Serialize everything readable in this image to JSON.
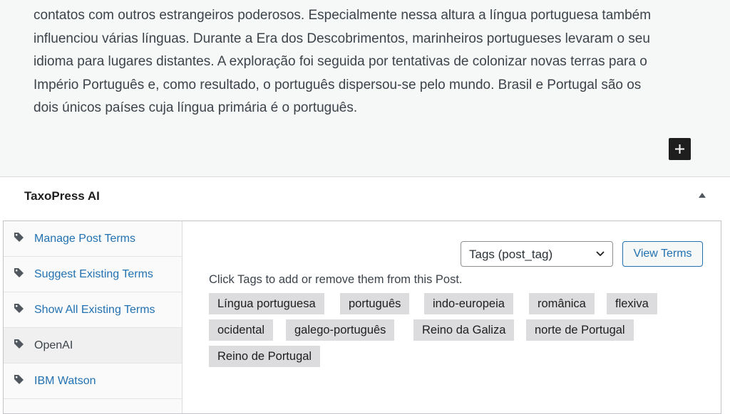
{
  "editor": {
    "paragraph_lines": [
      "contatos com outros estrangeiros poderosos. Especialmente nessa altura a língua portuguesa também",
      "influenciou várias línguas. Durante a Era dos Descobrimentos, marinheiros portugueses levaram o seu",
      "idioma para lugares distantes. A exploração foi seguida por tentativas de colonizar novas terras para o",
      "Império Português e, como resultado, o português dispersou-se pelo mundo. Brasil e Portugal são os",
      "dois únicos países cuja língua primária é o português."
    ],
    "inserter_icon": "plus-icon"
  },
  "panel": {
    "title": "TaxoPress AI",
    "toggle_icon": "triangle-up-icon"
  },
  "tabs": [
    {
      "label": "Manage Post Terms",
      "icon": "tag-icon",
      "active": false
    },
    {
      "label": "Suggest Existing Terms",
      "icon": "tag-icon",
      "active": false
    },
    {
      "label": "Show All Existing Terms",
      "icon": "tag-icon",
      "active": false
    },
    {
      "label": "OpenAI",
      "icon": "tag-icon",
      "active": true
    },
    {
      "label": "IBM Watson",
      "icon": "tag-icon",
      "active": false
    }
  ],
  "taxonomy_select": {
    "selected": "Tags (post_tag)"
  },
  "view_terms_label": "View Terms",
  "hint": "Click Tags to add or remove them from this Post.",
  "tags": [
    "Língua portuguesa",
    "português",
    "indo-europeia",
    "românica",
    "flexiva",
    "ocidental",
    "galego-português",
    "Reino da Galiza",
    "norte de Portugal",
    "Reino de Portugal"
  ],
  "colors": {
    "link": "#2271b1",
    "chip_bg": "#dcdcde",
    "editor_bg": "#f6f7f7"
  }
}
